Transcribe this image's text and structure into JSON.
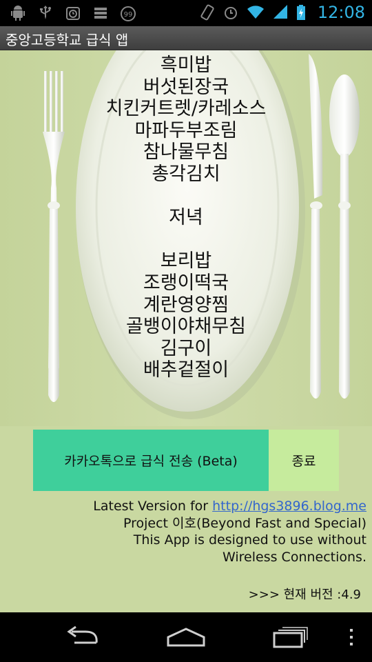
{
  "status_bar": {
    "time": "12:08",
    "notification_badge": "99",
    "left_icons": [
      "android-debug-icon",
      "usb-icon",
      "alarm-clock-icon",
      "storage-icon",
      "app-badge-icon"
    ],
    "right_icons": [
      "vibrate-icon",
      "alarm-icon",
      "wifi-icon",
      "signal-icon",
      "battery-charging-icon"
    ],
    "accent_color": "#33b5e5"
  },
  "app": {
    "title": "중앙고등학교 급식 앱"
  },
  "menu": {
    "lunch_items": [
      "흑미밥",
      "버섯된장국",
      "치킨커트렛/카레소스",
      "마파두부조림",
      "참나물무침",
      "총각김치"
    ],
    "dinner_heading": "저녁",
    "dinner_items": [
      "보리밥",
      "조랭이떡국",
      "계란영양찜",
      "골뱅이야채무침",
      "김구이",
      "배추겉절이"
    ]
  },
  "buttons": {
    "kakao_label": "카카오톡으로 급식 전송 (Beta)",
    "exit_label": "종료",
    "kakao_color": "#3fcf9b",
    "exit_color": "#c6eb9d"
  },
  "info": {
    "latest_prefix": "Latest Version for ",
    "blog_link": "http://hgs3896.blog.me",
    "project_line": "Project 이호(Beyond Fast and Special)",
    "wireless_line": "This App is designed to use without Wireless Connections.",
    "version_text": ">>> 현재 버전 :4.9"
  },
  "nav_bar": {
    "icons": [
      "back-icon",
      "home-icon",
      "recent-apps-icon",
      "overflow-menu-icon"
    ]
  }
}
